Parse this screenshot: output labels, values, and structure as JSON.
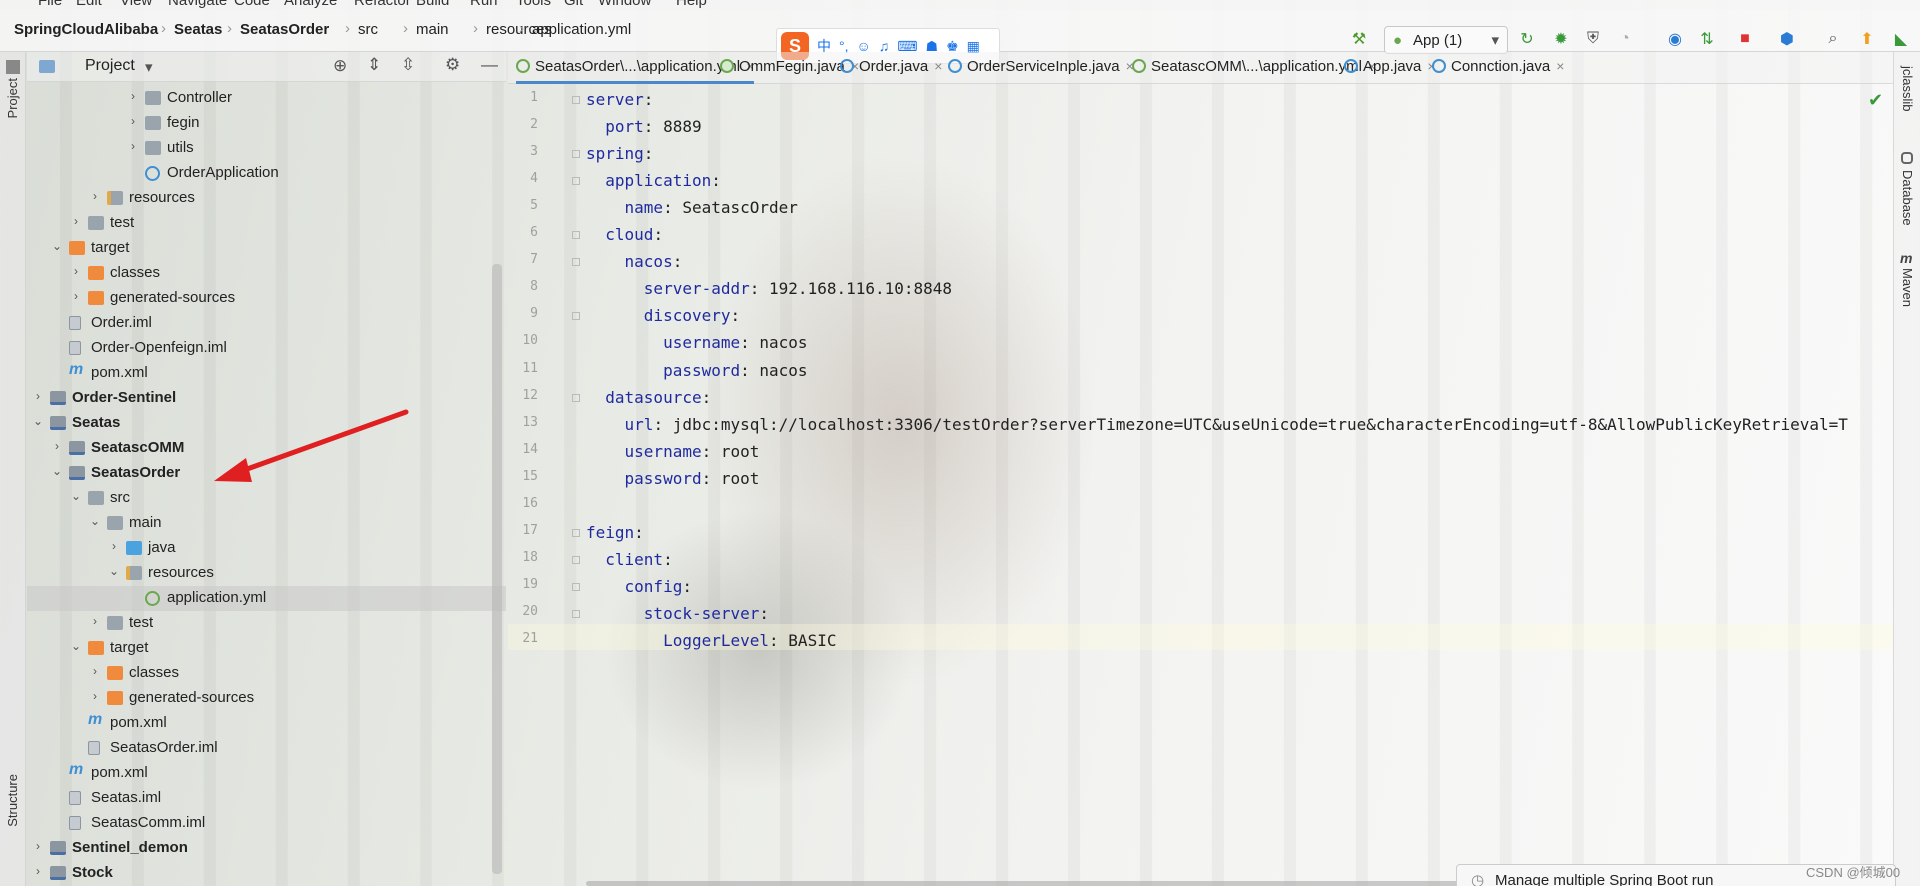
{
  "menu": [
    "File",
    "Edit",
    "View",
    "Navigate",
    "Code",
    "Analyze",
    "Refactor",
    "Build",
    "Run",
    "Tools",
    "Git",
    "Window",
    "Help"
  ],
  "breadcrumb": [
    "SpringCloudAlibaba",
    "Seatas",
    "SeatasOrder",
    "src",
    "main",
    "resources",
    "application.yml"
  ],
  "run_config": {
    "label": "App (1)"
  },
  "ime": {
    "logo": "S",
    "mode": "中"
  },
  "left_strip": {
    "project": "Project",
    "structure": "Structure"
  },
  "right_strip": {
    "jclasslib": "jclasslib",
    "database": "Database",
    "maven": "Maven"
  },
  "project_panel": {
    "title": "Project"
  },
  "tree": [
    {
      "label": "Controller",
      "depth": 6,
      "arrow": "closed",
      "icon": "folder",
      "bold": false
    },
    {
      "label": "fegin",
      "depth": 6,
      "arrow": "closed",
      "icon": "folder",
      "bold": false
    },
    {
      "label": "utils",
      "depth": 6,
      "arrow": "closed",
      "icon": "folder",
      "bold": false
    },
    {
      "label": "OrderApplication",
      "depth": 6,
      "arrow": "",
      "icon": "cls",
      "bold": false
    },
    {
      "label": "resources",
      "depth": 4,
      "arrow": "closed",
      "icon": "rfolder",
      "bold": false
    },
    {
      "label": "test",
      "depth": 3,
      "arrow": "closed",
      "icon": "folder",
      "bold": false
    },
    {
      "label": "target",
      "depth": 2,
      "arrow": "open",
      "icon": "ofolder",
      "bold": false
    },
    {
      "label": "classes",
      "depth": 3,
      "arrow": "closed",
      "icon": "ofolder",
      "bold": false
    },
    {
      "label": "generated-sources",
      "depth": 3,
      "arrow": "closed",
      "icon": "ofolder",
      "bold": false
    },
    {
      "label": "Order.iml",
      "depth": 2,
      "arrow": "",
      "icon": "iml",
      "bold": false
    },
    {
      "label": "Order-Openfeign.iml",
      "depth": 2,
      "arrow": "",
      "icon": "iml",
      "bold": false
    },
    {
      "label": "pom.xml",
      "depth": 2,
      "arrow": "",
      "icon": "m",
      "bold": false
    },
    {
      "label": "Order-Sentinel",
      "depth": 1,
      "arrow": "closed",
      "icon": "mod",
      "bold": true
    },
    {
      "label": "Seatas",
      "depth": 1,
      "arrow": "open",
      "icon": "mod",
      "bold": true
    },
    {
      "label": "SeatascOMM",
      "depth": 2,
      "arrow": "closed",
      "icon": "mod",
      "bold": true
    },
    {
      "label": "SeatasOrder",
      "depth": 2,
      "arrow": "open",
      "icon": "mod",
      "bold": true
    },
    {
      "label": "src",
      "depth": 3,
      "arrow": "open",
      "icon": "folder",
      "bold": false
    },
    {
      "label": "main",
      "depth": 4,
      "arrow": "open",
      "icon": "folder",
      "bold": false
    },
    {
      "label": "java",
      "depth": 5,
      "arrow": "closed",
      "icon": "bfolder",
      "bold": false
    },
    {
      "label": "resources",
      "depth": 5,
      "arrow": "open",
      "icon": "rfolder",
      "bold": false
    },
    {
      "label": "application.yml",
      "depth": 6,
      "arrow": "",
      "icon": "yml",
      "bold": false,
      "selected": true
    },
    {
      "label": "test",
      "depth": 4,
      "arrow": "closed",
      "icon": "folder",
      "bold": false
    },
    {
      "label": "target",
      "depth": 3,
      "arrow": "open",
      "icon": "ofolder",
      "bold": false
    },
    {
      "label": "classes",
      "depth": 4,
      "arrow": "closed",
      "icon": "ofolder",
      "bold": false
    },
    {
      "label": "generated-sources",
      "depth": 4,
      "arrow": "closed",
      "icon": "ofolder",
      "bold": false
    },
    {
      "label": "pom.xml",
      "depth": 3,
      "arrow": "",
      "icon": "m",
      "bold": false
    },
    {
      "label": "SeatasOrder.iml",
      "depth": 3,
      "arrow": "",
      "icon": "iml",
      "bold": false
    },
    {
      "label": "pom.xml",
      "depth": 2,
      "arrow": "",
      "icon": "m",
      "bold": false
    },
    {
      "label": "Seatas.iml",
      "depth": 2,
      "arrow": "",
      "icon": "iml",
      "bold": false
    },
    {
      "label": "SeatasComm.iml",
      "depth": 2,
      "arrow": "",
      "icon": "iml",
      "bold": false
    },
    {
      "label": "Sentinel_demon",
      "depth": 1,
      "arrow": "closed",
      "icon": "mod",
      "bold": true
    },
    {
      "label": "Stock",
      "depth": 1,
      "arrow": "closed",
      "icon": "mod",
      "bold": true
    }
  ],
  "tabs": [
    {
      "label": "SeatasOrder\\...\\application.yml",
      "icon": "y",
      "active": true
    },
    {
      "label": "OmmFegin.java",
      "icon": "i",
      "active": false
    },
    {
      "label": "Order.java",
      "icon": "c",
      "active": false
    },
    {
      "label": "OrderServiceInple.java",
      "icon": "c",
      "active": false
    },
    {
      "label": "SeatascOMM\\...\\application.yml",
      "icon": "y",
      "active": false
    },
    {
      "label": "App.java",
      "icon": "c",
      "active": false
    },
    {
      "label": "Connction.java",
      "icon": "c",
      "active": false
    }
  ],
  "code": [
    [
      {
        "k": "server"
      },
      {
        "t": ":"
      }
    ],
    [
      {
        "t": "  "
      },
      {
        "k": "port"
      },
      {
        "t": ": 8889"
      }
    ],
    [
      {
        "k": "spring"
      },
      {
        "t": ":"
      }
    ],
    [
      {
        "t": "  "
      },
      {
        "k": "application"
      },
      {
        "t": ":"
      }
    ],
    [
      {
        "t": "    "
      },
      {
        "k": "name"
      },
      {
        "t": ": SeatascOrder"
      }
    ],
    [
      {
        "t": "  "
      },
      {
        "k": "cloud"
      },
      {
        "t": ":"
      }
    ],
    [
      {
        "t": "    "
      },
      {
        "k": "nacos"
      },
      {
        "t": ":"
      }
    ],
    [
      {
        "t": "      "
      },
      {
        "k": "server-addr"
      },
      {
        "t": ": 192.168.116.10:8848"
      }
    ],
    [
      {
        "t": "      "
      },
      {
        "k": "discovery"
      },
      {
        "t": ":"
      }
    ],
    [
      {
        "t": "        "
      },
      {
        "k": "username"
      },
      {
        "t": ": nacos"
      }
    ],
    [
      {
        "t": "        "
      },
      {
        "k": "password"
      },
      {
        "t": ": nacos"
      }
    ],
    [
      {
        "t": "  "
      },
      {
        "k": "datasource"
      },
      {
        "t": ":"
      }
    ],
    [
      {
        "t": "    "
      },
      {
        "k": "url"
      },
      {
        "t": ": jdbc:mysql://localhost:3306/testOrder?serverTimezone=UTC&useUnicode=true&characterEncoding=utf-8&AllowPublicKeyRetrieval=T"
      }
    ],
    [
      {
        "t": "    "
      },
      {
        "k": "username"
      },
      {
        "t": ": root"
      }
    ],
    [
      {
        "t": "    "
      },
      {
        "k": "password"
      },
      {
        "t": ": root"
      }
    ],
    [],
    [
      {
        "k": "feign"
      },
      {
        "t": ":"
      }
    ],
    [
      {
        "t": "  "
      },
      {
        "k": "client"
      },
      {
        "t": ":"
      }
    ],
    [
      {
        "t": "    "
      },
      {
        "k": "config"
      },
      {
        "t": ":"
      }
    ],
    [
      {
        "t": "      "
      },
      {
        "k": "stock-server"
      },
      {
        "t": ":"
      }
    ],
    [
      {
        "t": "        "
      },
      {
        "k": "LoggerLevel"
      },
      {
        "t": ": BASIC"
      }
    ]
  ],
  "popup": {
    "text": "Manage multiple Spring Boot run"
  },
  "watermark": "CSDN @倾城00",
  "colors": {
    "key": "#1f2a9f",
    "arrow": "#e02020",
    "accent": "#4a88c7"
  }
}
